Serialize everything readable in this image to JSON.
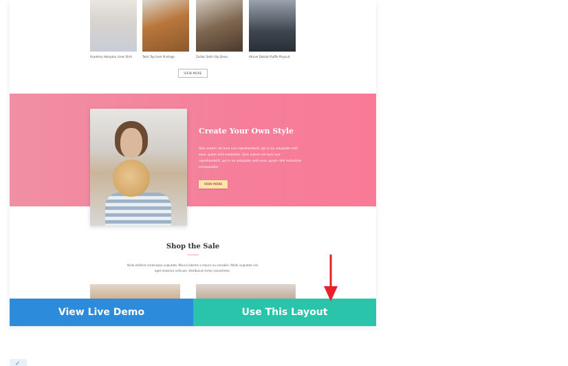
{
  "products": [
    {
      "caption": "Academy Hampton Linen Shirt"
    },
    {
      "caption": "Twist Top from Privilege"
    },
    {
      "caption": "Zodiac Satin Slip Dress"
    },
    {
      "caption": "Atrium Dakkah Ruffle Playsuit"
    }
  ],
  "view_more_top": "VIEW MORE",
  "banner": {
    "title": "Create Your Own Style",
    "text": "Quis autem vel eum iure reprehenderit, qui in ea voluptate velit esse, quam nihil molestiae. Quis autem vel eum iure reprehenderit, qui in ea voluptate velit esse, quam nihil molestiae consequatur.",
    "button": "VIEW MORE"
  },
  "sale": {
    "title": "Shop the Sale",
    "text": "Nulla eleifend scelerisque vulputate. Mauris lobortis a mauris eu convallis. Morbi vulputate nisl eget maximus vehicula. Vestibulum tortor consectetur."
  },
  "actions": {
    "demo_label": "View Live Demo",
    "use_label": "Use This Layout"
  },
  "colors": {
    "demo": "#2d8bdc",
    "use": "#29c4a9",
    "banner_pink": "#f57f9b",
    "arrow": "#e8202a"
  },
  "corner_icon": "check-icon"
}
